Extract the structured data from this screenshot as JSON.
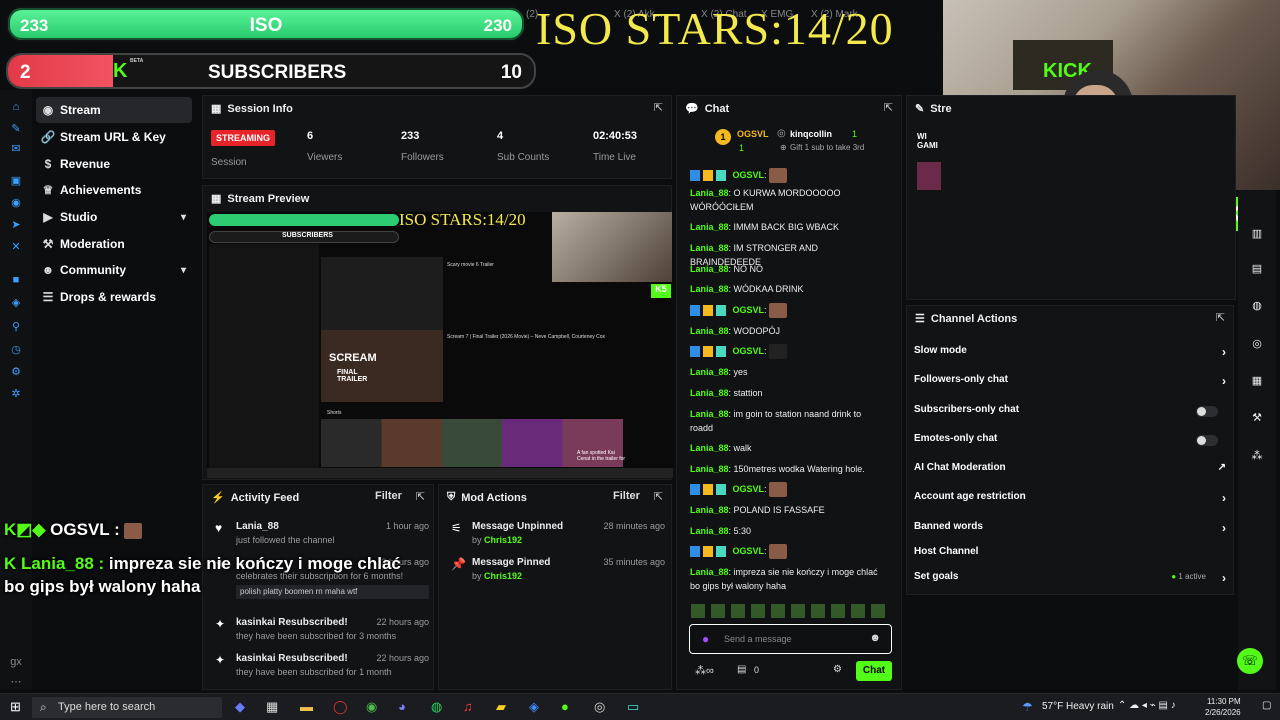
{
  "overlay": {
    "iso_left": "233",
    "iso_label": "ISO",
    "iso_right": "230",
    "subs_left": "2",
    "subs_label": "SUBSCRIBERS",
    "subs_right": "10",
    "subs_progress": 0.2,
    "iso_stars": "ISO STARS:14/20",
    "kick_logo": "K",
    "beta": "BETA"
  },
  "browser_tabs": [
    "(2) ...",
    "X (2) Akk...",
    "X (2) Chat",
    "X EMG",
    "X (2) Mark"
  ],
  "nav": {
    "items": [
      {
        "label": "Stream",
        "icon": "broadcast-icon",
        "active": true
      },
      {
        "label": "Stream URL & Key",
        "icon": "link-icon"
      },
      {
        "label": "Revenue",
        "icon": "dollar-icon"
      },
      {
        "label": "Achievements",
        "icon": "trophy-icon"
      },
      {
        "label": "Studio",
        "icon": "video-icon",
        "expandable": true
      },
      {
        "label": "Moderation",
        "icon": "gavel-icon"
      },
      {
        "label": "Community",
        "icon": "people-icon",
        "expandable": true
      },
      {
        "label": "Drops & rewards",
        "icon": "gift-icon"
      }
    ]
  },
  "session": {
    "title": "Session Info",
    "status": "STREAMING",
    "session_label": "Session",
    "stats": [
      {
        "value": "6",
        "label": "Viewers"
      },
      {
        "value": "233",
        "label": "Followers"
      },
      {
        "value": "4",
        "label": "Sub Counts"
      },
      {
        "value": "02:40:53",
        "label": "Time Live"
      }
    ]
  },
  "preview": {
    "title": "Stream Preview",
    "mini_iso_stars": "ISO STARS:14/20",
    "mini_subs": "SUBSCRIBERS",
    "video_title_1": "Scary movie 6 Trailer",
    "video_title_2": "Scream 7 | Final Trailer (2026 Movie) – Neve Campbell, Courteney Cox",
    "scream_title": "SCREAM",
    "scream_sub": "FINAL TRAILER",
    "shorts": "Shorts",
    "short_caption": "A fan spotted Kai Cenat in the trailer for"
  },
  "activity": {
    "title": "Activity Feed",
    "filter": "Filter",
    "items": [
      {
        "title": "Lania_88",
        "sub": "just followed the channel",
        "time": "1 hour ago",
        "icon": "heart-icon"
      },
      {
        "title": "...",
        "sub": "celebrates their subscription for 6 months!",
        "extra": "polish platty boomen rn maha wtf",
        "time": "2 hours ago",
        "icon": "star-icon"
      },
      {
        "title": "kasinkai Resubscribed!",
        "sub": "they have been subscribed for 3 months",
        "time": "22 hours ago",
        "icon": "sparkle-icon"
      },
      {
        "title": "kasinkai Resubscribed!",
        "sub": "they have been subscribed for 1 month",
        "time": "22 hours ago",
        "icon": "sparkle-icon"
      }
    ]
  },
  "mod": {
    "title": "Mod Actions",
    "filter": "Filter",
    "items": [
      {
        "title": "Message Unpinned",
        "by": "by",
        "user": "Chris192",
        "time": "28 minutes ago",
        "icon": "unpin-icon"
      },
      {
        "title": "Message Pinned",
        "by": "by",
        "user": "Chris192",
        "time": "35 minutes ago",
        "icon": "pin-icon"
      }
    ]
  },
  "chat": {
    "title": "Chat",
    "gifter_rank": "1",
    "gifter_name": "OGSVL",
    "gifter_count": "1",
    "leader_name": "kinqcollin",
    "leader_count": "1",
    "leader_sub": "Gift 1 sub to take 3rd",
    "messages": [
      {
        "user": "OGSVL",
        "text": "",
        "emote": true
      },
      {
        "user": "Lania_88",
        "text": "O KURWA MORDOOOOO WÓRÓÓCIŁEM"
      },
      {
        "user": "Lania_88",
        "text": "IMMM BACK BIG WBACK"
      },
      {
        "user": "Lania_88",
        "text": "IM STRONGER AND BRAINDEDEEDE"
      },
      {
        "user": "Lania_88",
        "text": "NO NO"
      },
      {
        "user": "Lania_88",
        "text": "WÓDKAA DRINK"
      },
      {
        "user": "OGSVL",
        "text": "",
        "emote": true
      },
      {
        "user": "Lania_88",
        "text": "WODOPÓJ"
      },
      {
        "user": "OGSVL",
        "text": "",
        "emote": true
      },
      {
        "user": "Lania_88",
        "text": "yes"
      },
      {
        "user": "Lania_88",
        "text": "stattion"
      },
      {
        "user": "Lania_88",
        "text": "im goin to station naand drink to roadd"
      },
      {
        "user": "Lania_88",
        "text": "walk"
      },
      {
        "user": "Lania_88",
        "text": "150metres wodka Watering hole."
      },
      {
        "user": "OGSVL",
        "text": "",
        "emote": true
      },
      {
        "user": "Lania_88",
        "text": "POLAND IS FASSAFE"
      },
      {
        "user": "Lania_88",
        "text": "5:30"
      },
      {
        "user": "OGSVL",
        "text": "",
        "emote": true
      },
      {
        "user": "Lania_88",
        "text": "impreza sie nie kończy i moge chlać bo gips był walony haha"
      }
    ],
    "input_placeholder": "Send a message",
    "points": "0",
    "send": "Chat"
  },
  "channel_actions": {
    "title": "Channel Actions",
    "rows": [
      {
        "label": "Slow mode",
        "control": "arrow"
      },
      {
        "label": "Followers-only chat",
        "control": "arrow"
      },
      {
        "label": "Subscribers-only chat",
        "control": "toggle"
      },
      {
        "label": "Emotes-only chat",
        "control": "toggle"
      },
      {
        "label": "AI Chat Moderation",
        "control": "external"
      },
      {
        "label": "Account age restriction",
        "control": "arrow"
      },
      {
        "label": "Banned words",
        "control": "arrow"
      },
      {
        "label": "Host Channel",
        "control": "none"
      },
      {
        "label": "Set goals",
        "control": "arrow",
        "badge": "1 active"
      }
    ]
  },
  "stream_panel_peek": {
    "title": "Stre",
    "text": "WI GAMI"
  },
  "webcam_badge": "5",
  "overlay_chat": {
    "line1_user": "OGSVL :",
    "line2_user": "Lania_88 :",
    "line2_text": "impreza sie nie kończy i moge chlać bo gips był walony haha"
  },
  "taskbar": {
    "search_placeholder": "Type here to search",
    "weather_temp": "57°F",
    "weather_desc": "Heavy rain",
    "time": "11:30 PM",
    "date": "2/26/2026"
  },
  "colors": {
    "kick_green": "#53fc18",
    "iso_green": "#25c76a",
    "sub_red": "#e23a46",
    "stars_yellow": "#f4e94c",
    "badge_blue": "#2e8ee6"
  }
}
